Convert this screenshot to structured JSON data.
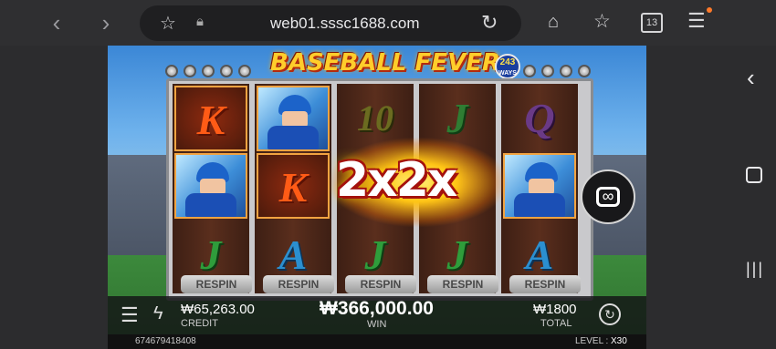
{
  "browser": {
    "url": "web01.sssc1688.com",
    "tab_count": "13"
  },
  "game": {
    "title": "BASEBALL FEVER",
    "ways_badge_top": "243",
    "ways_badge_bottom": "WAYS",
    "reels": [
      [
        "K",
        "",
        "J"
      ],
      [
        "player",
        "K",
        "A"
      ],
      [
        "10",
        "",
        "J"
      ],
      [
        "J",
        "",
        "J"
      ],
      [
        "Q",
        "player",
        "A"
      ]
    ],
    "multiplier_text": "2x2x",
    "respin_label": "RESPIN",
    "credit_value": "₩65,263.00",
    "credit_label": "CREDIT",
    "win_value": "₩366,000.00",
    "win_label": "WIN",
    "total_value": "₩1800",
    "total_label": "TOTAL",
    "session_id": "674679418408",
    "level_label": "LEVEL :",
    "level_value": "X30"
  }
}
